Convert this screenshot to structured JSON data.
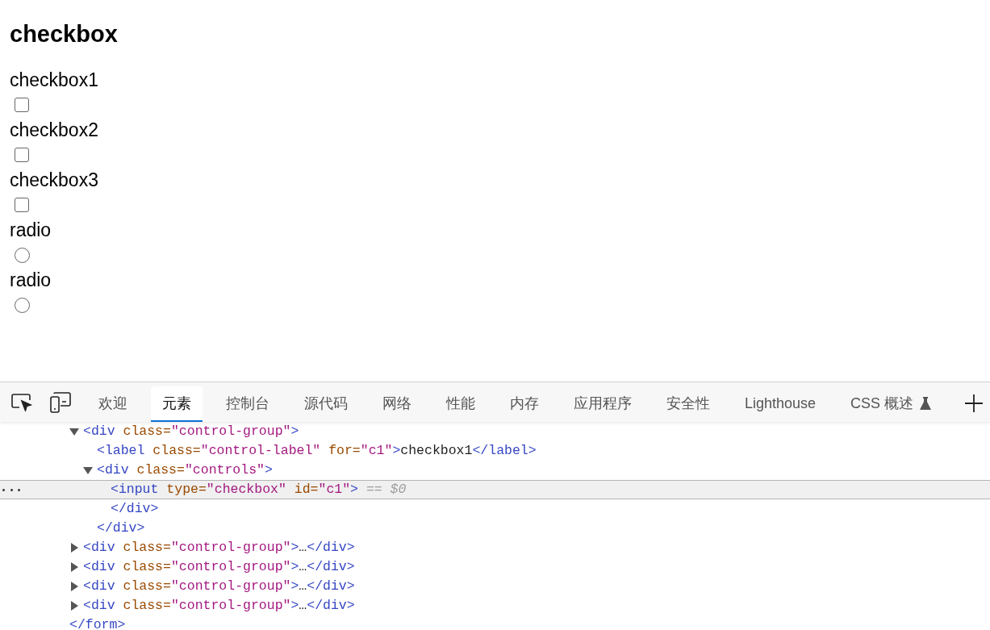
{
  "page": {
    "heading": "checkbox",
    "fields": [
      {
        "label": "checkbox1",
        "kind": "checkbox",
        "checked": false
      },
      {
        "label": "checkbox2",
        "kind": "checkbox",
        "checked": false
      },
      {
        "label": "checkbox3",
        "kind": "checkbox",
        "checked": false
      },
      {
        "label": "radio",
        "kind": "radio",
        "checked": false
      },
      {
        "label": "radio",
        "kind": "radio",
        "checked": false
      }
    ]
  },
  "devtools": {
    "tabs": [
      {
        "label": "欢迎",
        "selected": false
      },
      {
        "label": "元素",
        "selected": true
      },
      {
        "label": "控制台",
        "selected": false
      },
      {
        "label": "源代码",
        "selected": false
      },
      {
        "label": "网络",
        "selected": false
      },
      {
        "label": "性能",
        "selected": false
      },
      {
        "label": "内存",
        "selected": false
      },
      {
        "label": "应用程序",
        "selected": false
      },
      {
        "label": "安全性",
        "selected": false
      },
      {
        "label": "Lighthouse",
        "selected": false
      },
      {
        "label": "CSS 概述",
        "selected": false,
        "experimental": true
      }
    ],
    "tree": [
      {
        "closing": [
          {
            "kind": "tag",
            "text": "</form>"
          }
        ],
        "children": [
          {
            "expanded": true,
            "selected": false,
            "tokens": [
              {
                "kind": "tag",
                "text": "<div"
              },
              {
                "kind": "attr",
                "text": " class="
              },
              {
                "kind": "value",
                "text": "\"control-group\""
              },
              {
                "kind": "tag",
                "text": ">"
              }
            ],
            "closing": [
              {
                "kind": "tag",
                "text": "</div>"
              }
            ],
            "children": [
              {
                "selected": false,
                "tokens": [
                  {
                    "kind": "tag",
                    "text": "<label"
                  },
                  {
                    "kind": "attr",
                    "text": " class="
                  },
                  {
                    "kind": "value",
                    "text": "\"control-label\""
                  },
                  {
                    "kind": "attr",
                    "text": " for="
                  },
                  {
                    "kind": "value",
                    "text": "\"c1\""
                  },
                  {
                    "kind": "tag",
                    "text": ">"
                  },
                  {
                    "kind": "text",
                    "text": "checkbox1"
                  },
                  {
                    "kind": "tag",
                    "text": "</label>"
                  }
                ]
              },
              {
                "expanded": true,
                "selected": false,
                "tokens": [
                  {
                    "kind": "tag",
                    "text": "<div"
                  },
                  {
                    "kind": "attr",
                    "text": " class="
                  },
                  {
                    "kind": "value",
                    "text": "\"controls\""
                  },
                  {
                    "kind": "tag",
                    "text": ">"
                  }
                ],
                "closing": [
                  {
                    "kind": "tag",
                    "text": "</div>"
                  }
                ],
                "children": [
                  {
                    "selected": true,
                    "tokens": [
                      {
                        "kind": "tag",
                        "text": "<input"
                      },
                      {
                        "kind": "attr",
                        "text": " type="
                      },
                      {
                        "kind": "value",
                        "text": "\"checkbox\""
                      },
                      {
                        "kind": "attr",
                        "text": " id="
                      },
                      {
                        "kind": "value",
                        "text": "\"c1\""
                      },
                      {
                        "kind": "tag",
                        "text": ">"
                      },
                      {
                        "kind": "hint",
                        "text": " == $0"
                      }
                    ]
                  }
                ]
              }
            ]
          },
          {
            "expanded": false,
            "selected": false,
            "tokens": [
              {
                "kind": "tag",
                "text": "<div"
              },
              {
                "kind": "attr",
                "text": " class="
              },
              {
                "kind": "value",
                "text": "\"control-group\""
              },
              {
                "kind": "tag",
                "text": ">"
              },
              {
                "kind": "text",
                "text": "…"
              },
              {
                "kind": "tag",
                "text": "</div>"
              }
            ]
          },
          {
            "expanded": false,
            "selected": false,
            "tokens": [
              {
                "kind": "tag",
                "text": "<div"
              },
              {
                "kind": "attr",
                "text": " class="
              },
              {
                "kind": "value",
                "text": "\"control-group\""
              },
              {
                "kind": "tag",
                "text": ">"
              },
              {
                "kind": "text",
                "text": "…"
              },
              {
                "kind": "tag",
                "text": "</div>"
              }
            ]
          },
          {
            "expanded": false,
            "selected": false,
            "tokens": [
              {
                "kind": "tag",
                "text": "<div"
              },
              {
                "kind": "attr",
                "text": " class="
              },
              {
                "kind": "value",
                "text": "\"control-group\""
              },
              {
                "kind": "tag",
                "text": ">"
              },
              {
                "kind": "text",
                "text": "…"
              },
              {
                "kind": "tag",
                "text": "</div>"
              }
            ]
          },
          {
            "expanded": false,
            "selected": false,
            "tokens": [
              {
                "kind": "tag",
                "text": "<div"
              },
              {
                "kind": "attr",
                "text": " class="
              },
              {
                "kind": "value",
                "text": "\"control-group\""
              },
              {
                "kind": "tag",
                "text": ">"
              },
              {
                "kind": "text",
                "text": "…"
              },
              {
                "kind": "tag",
                "text": "</div>"
              }
            ]
          }
        ]
      }
    ]
  }
}
